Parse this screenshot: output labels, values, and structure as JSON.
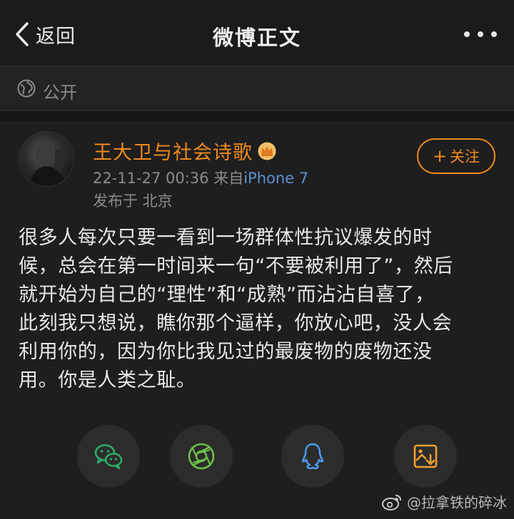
{
  "header": {
    "back_label": "返回",
    "title": "微博正文",
    "more_icon": "more-dots-icon"
  },
  "visibility": {
    "icon": "globe-icon",
    "label": "公开"
  },
  "post": {
    "author": "王大卫与社会诗歌",
    "badge_icon": "crown-badge-icon",
    "timestamp": "22-11-27 00:36",
    "source_prefix": "来自",
    "source": "iPhone 7",
    "location": "发布于 北京",
    "follow_label": "关注",
    "content_lines": [
      "很多人每次只要一看到一场群体性抗议爆发的时",
      "候，总会在第一时间来一句“不要被利用了”，然后",
      "就开始为自己的“理性”和“成熟”而沾沾自喜了，",
      "此刻我只想说，瞧你那个逼样，你放心吧，没人会",
      "利用你的，因为你比我见过的最废物的废物还没",
      "用。你是人类之耻。"
    ]
  },
  "share": {
    "buttons": [
      "wechat-icon",
      "moments-icon",
      "qq-icon",
      "save-image-icon"
    ]
  },
  "watermark": {
    "text": "@拉拿铁的碎冰"
  },
  "colors": {
    "accent": "#f08a1c",
    "link": "#5f8fd1",
    "wechat": "#2aae67",
    "moments": "#6cc24a",
    "qq": "#4b9cf0",
    "save": "#f0a030"
  }
}
